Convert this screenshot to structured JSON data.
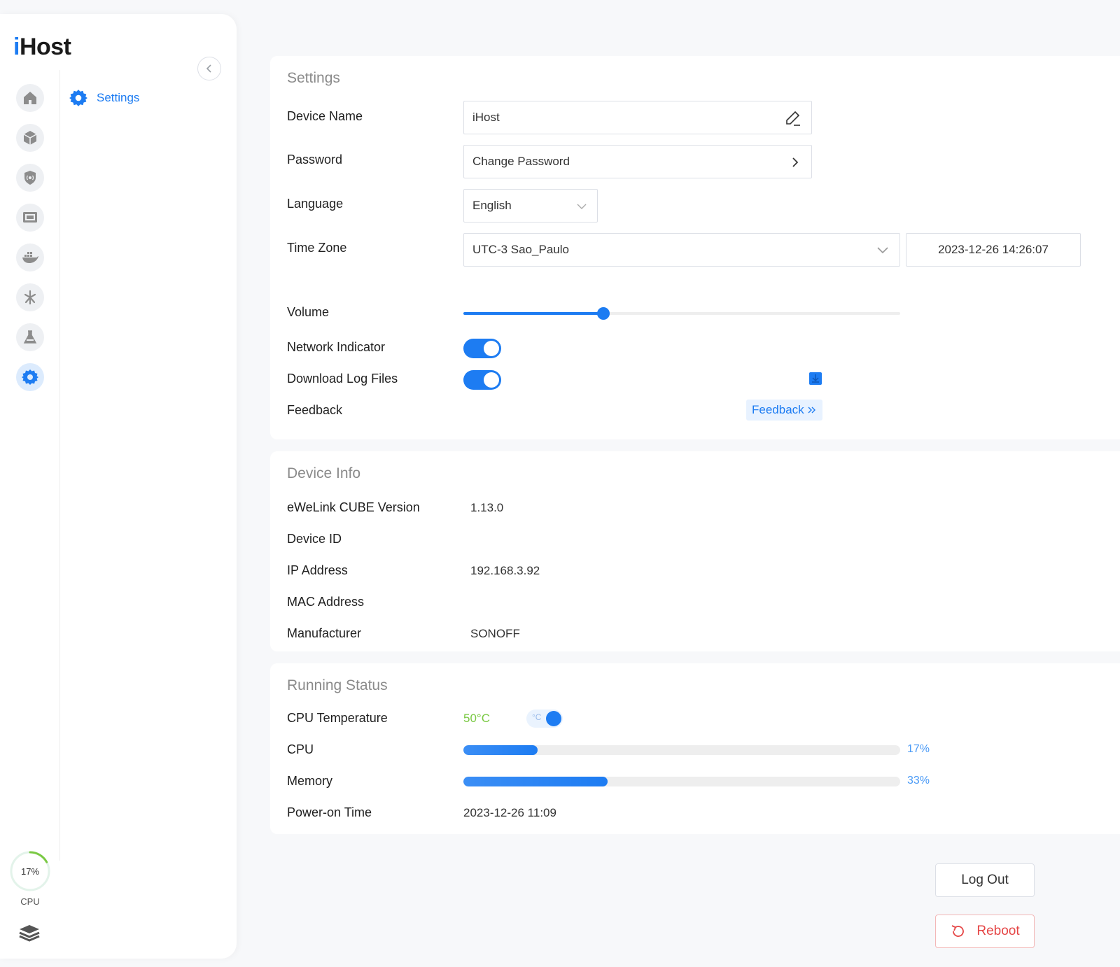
{
  "sidebar": {
    "logo_i": "i",
    "logo_rest": "Host",
    "active_menu_label": "Settings",
    "cpu_percent_text": "17%",
    "cpu_percent_value": 17,
    "cpu_label": "CPU",
    "rail_icons": [
      "home-icon",
      "cube-icon",
      "shield-signal-icon",
      "monitor-icon",
      "docker-icon",
      "node-red-icon",
      "lab-flask-icon",
      "gear-icon"
    ],
    "accent_color": "#1d7cf2",
    "ring_color": "#7ac943"
  },
  "settings": {
    "title": "Settings",
    "device_name_label": "Device Name",
    "device_name_value": "iHost",
    "password_label": "Password",
    "password_value": "Change Password",
    "language_label": "Language",
    "language_value": "English",
    "timezone_label": "Time Zone",
    "timezone_value": "UTC-3 Sao_Paulo",
    "datetime_value": "2023-12-26 14:26:07",
    "volume_label": "Volume",
    "volume_fraction": 0.32,
    "network_indicator_label": "Network Indicator",
    "network_indicator_on": true,
    "download_logs_label": "Download Log Files",
    "download_logs_on": true,
    "feedback_label": "Feedback",
    "feedback_button": "Feedback"
  },
  "device_info": {
    "title": "Device Info",
    "version_label": "eWeLink CUBE Version",
    "version_value": "1.13.0",
    "device_id_label": "Device ID",
    "device_id_value": "",
    "ip_label": "IP Address",
    "ip_value": "192.168.3.92",
    "mac_label": "MAC Address",
    "mac_value": "",
    "manufacturer_label": "Manufacturer",
    "manufacturer_value": "SONOFF"
  },
  "running_status": {
    "title": "Running Status",
    "cpu_temp_label": "CPU Temperature",
    "cpu_temp_value": "50°C",
    "temp_unit_toggle": "°C",
    "cpu_label": "CPU",
    "cpu_percent": "17%",
    "cpu_fraction": 0.17,
    "memory_label": "Memory",
    "memory_percent": "33%",
    "memory_fraction": 0.33,
    "power_on_label": "Power-on Time",
    "power_on_value": "2023-12-26 11:09"
  },
  "actions": {
    "logout_label": "Log Out",
    "reboot_label": "Reboot"
  }
}
